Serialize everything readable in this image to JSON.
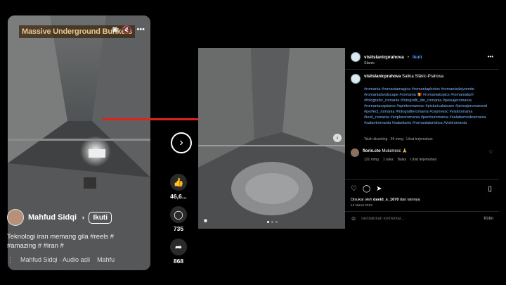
{
  "reel": {
    "overlay_title": "Massive Underground Bunkers",
    "top_icons": [
      "volume-icon",
      "mute-icon",
      "more-icon"
    ],
    "user": {
      "name": "Mahfud Sidqi",
      "verified_glyph": "◑",
      "follow_label": "Ikuti"
    },
    "caption": "Teknologi iran memang gila #reels # #amazing # #iran #",
    "audio_text": "Mahfud Sidqi · Audio asli",
    "audio_scroll": "Mahfu"
  },
  "actions": [
    {
      "name": "like",
      "icon": "heart-icon",
      "count": "46,6..."
    },
    {
      "name": "comment",
      "icon": "comment-icon",
      "count": "735"
    },
    {
      "name": "share",
      "icon": "share-icon",
      "count": "868"
    }
  ],
  "post": {
    "username": "visitslanicprahova",
    "follow_label": "Ikuti",
    "location": "Slanic",
    "caption_user": "visitslanicprahova",
    "caption_text": "Salina Slănic-Prahova",
    "hashtags": "#romania #romaniamagica #romaniaphotos #romaniadejvomde #romanialandscape #romania 🇷🇴 #romaniatopics #romaniaturil #fotografer_romania #fotografii_din_romania #peisajeromania #romaniacaptures #spiritromanesc #picturicalatoare #peisajeromanesti #perfect_romania #fotografieromania #ceprivesc #visitromania #iezil_romania #exploreromania #pentruromania #salabomedeomania #salantromania #salaslanic #romaniaturistica #visitromania",
    "caption_meta": "Telah disunting · 96 mmg · Lihat terjemahan",
    "comment_user": "florin.cto",
    "comment_text": "Mulumesc 🙏",
    "comment_meta": [
      "121 mmg",
      "1 suka",
      "Balas",
      "Lihat terjemahan"
    ],
    "liked_by_prefix": "Disukai oleh",
    "liked_by_user": "david_s_1070",
    "liked_by_suffix": "dan lainnya",
    "date": "13 Maret 2023",
    "comment_placeholder": "Tambahkan komentar...",
    "send_label": "Kirim"
  }
}
